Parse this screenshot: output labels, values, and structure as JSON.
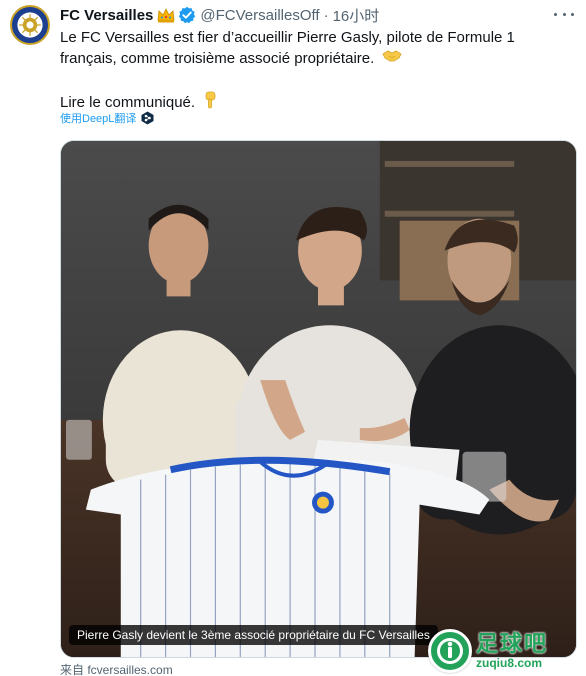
{
  "tweet": {
    "author_name": "FC Versailles",
    "author_handle": "@FCVersaillesOff",
    "separator": "·",
    "timestamp": "16小时",
    "text_line_1": "Le FC Versailles est fier d’accueillir Pierre Gasly, pilote de Formule 1 français, comme troisième associé propriétaire.",
    "text_line_2": "Lire le communiqué.",
    "translate_label": "使用DeepL翻译",
    "source_label": "来自 fcversailles.com"
  },
  "media": {
    "caption": "Pierre Gasly devient le 3ème associé propriétaire du FC Versailles"
  },
  "watermark": {
    "brand_cn": "足球吧",
    "brand_url": "zuqiu8.com"
  },
  "icons": {
    "avatar": "fc-versailles-logo",
    "crown": "crown-emoji-icon",
    "verified": "verified-badge-icon",
    "more": "more-options-icon",
    "handshake": "handshake-emoji-icon",
    "point_down": "pointing-down-emoji-icon",
    "deepl": "deepl-icon"
  },
  "colors": {
    "link": "#1d9bf0",
    "muted": "#536471",
    "club_blue": "#1d3f8f",
    "watermark_green": "#23a35a"
  }
}
